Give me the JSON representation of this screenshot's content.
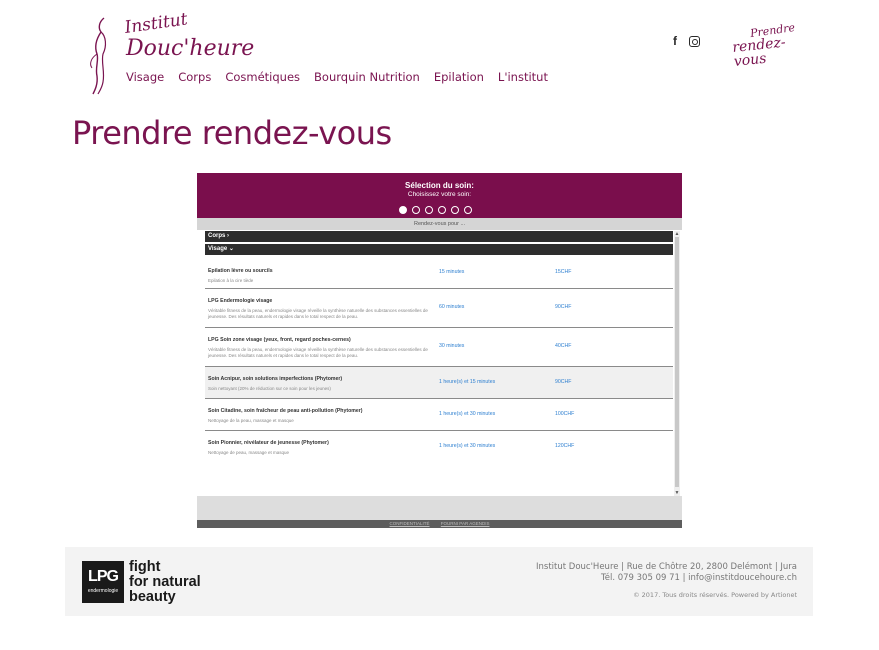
{
  "header": {
    "logo": {
      "line1": "Institut",
      "line2": "Douc'heure"
    },
    "nav": [
      "Visage",
      "Corps",
      "Cosmétiques",
      "Bourquin Nutrition",
      "Epilation",
      "L'institut"
    ],
    "social": {
      "facebook": "f",
      "instagram": "instagram-icon"
    },
    "cta": {
      "line1": "Prendre",
      "line2": "rendez-vous"
    }
  },
  "page_title": "Prendre rendez-vous",
  "widget": {
    "title": "Sélection du soin:",
    "subtitle": "Choisissez votre soin:",
    "steps_total": 6,
    "steps_active": 1,
    "bar_label": "Rendez-vous pour ...",
    "categories": [
      {
        "label": "Corps ›"
      },
      {
        "label": "Visage ⌄"
      }
    ],
    "services": [
      {
        "name": "Epilation lèvre ou sourcils",
        "desc": "Epilation à la cire tiède",
        "duration": "15 minutes",
        "price": "15CHF"
      },
      {
        "name": "LPG Endermologie visage",
        "desc": "Véritable fitness de la peau, endermologie visage réveille la synthèse naturelle des substances essentielles de jeunesse. Des résultats naturels et rapides dans le total respect de la peau.",
        "duration": "60 minutes",
        "price": "90CHF"
      },
      {
        "name": "LPG Soin zone visage (yeux, front, regard poches-cernes)",
        "desc": "Véritable fitness de la peau, endermologie visage réveille la synthèse naturelle des substances essentielles de jeunesse. Des résultats naturels et rapides dans le total respect de la peau.",
        "duration": "30 minutes",
        "price": "40CHF"
      },
      {
        "name": "Soin Acnipur, soin solutions imperfections (Phytomer)",
        "desc": "Soin nettoyant (20% de réduction sur ce soin pour les jeunes)",
        "duration": "1 heure(s) et 15 minutes",
        "price": "90CHF"
      },
      {
        "name": "Soin Citadine, soin fraîcheur de peau anti-pollution (Phytomer)",
        "desc": "Nettoyage de la peau, massage et masque",
        "duration": "1 heure(s) et 30 minutes",
        "price": "100CHF"
      },
      {
        "name": "Soin Pionnier, révélateur de jeunesse (Phytomer)",
        "desc": "Nettoyage de peau, massage et masque",
        "duration": "1 heure(s) et 30 minutes",
        "price": "120CHF"
      }
    ],
    "footer_links": [
      "CONFIDENTIALITÉ",
      "FOURNI PAR AGENDIS"
    ]
  },
  "footer": {
    "lpg": "LPG",
    "lpg_sub": "endermologie",
    "slogan": [
      "fight",
      "for natural",
      "beauty"
    ],
    "address": "Institut Douc'Heure | Rue de Chôtre 20, 2800 Delémont | Jura",
    "contact": "Tél. 079 305 09 71 | info@institdoucehoure.ch",
    "copyright": "© 2017. Tous droits réservés. Powered by Artionet"
  }
}
